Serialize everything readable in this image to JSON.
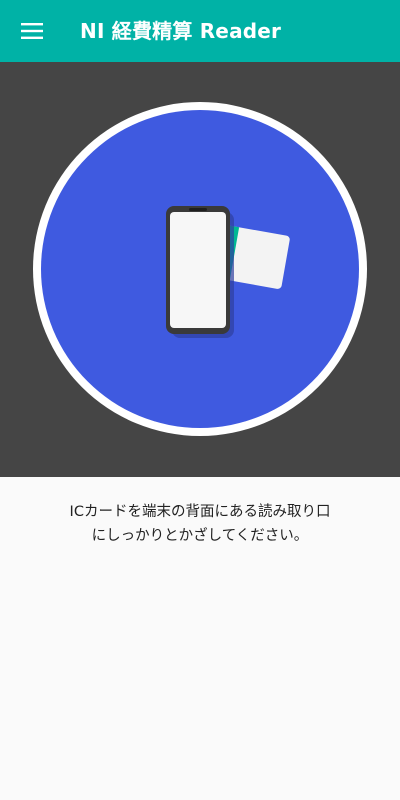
{
  "app_bar": {
    "title": "NI 経費精算 Reader",
    "menu_icon": "hamburger-menu-icon",
    "background_color": "#00b2a6"
  },
  "hero": {
    "background_color": "#454545",
    "circle_color": "#3f5ae0",
    "illustration": "phone-tap-ic-card-icon",
    "card_accent_color": "#00b894"
  },
  "instruction": {
    "line1": "ICカードを端末の背面にある読み取り口",
    "line2": "にしっかりとかざしてください。"
  }
}
